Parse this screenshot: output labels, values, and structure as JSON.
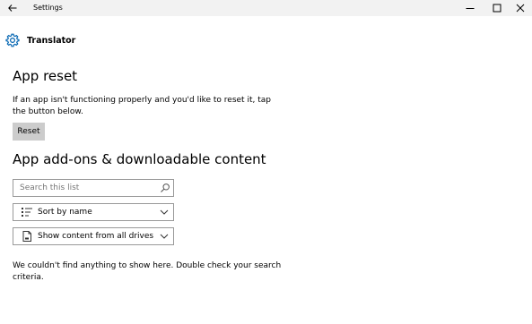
{
  "window": {
    "title": "Settings"
  },
  "header": {
    "app_name": "Translator"
  },
  "reset_section": {
    "title": "App reset",
    "description": "If an app isn't functioning properly and you'd like to reset it, tap the button below.",
    "button_label": "Reset"
  },
  "addons_section": {
    "title": "App add-ons & downloadable content",
    "search": {
      "placeholder": "Search this list",
      "value": ""
    },
    "sort": {
      "selected": "Sort by name"
    },
    "drives": {
      "selected": "Show content from all drives"
    },
    "empty_message": "We couldn't find anything to show here. Double check your search criteria."
  },
  "icons": {
    "back": "back-arrow-icon",
    "minimize": "minimize-icon",
    "maximize": "maximize-icon",
    "close": "close-icon",
    "settings": "gear-icon",
    "search": "search-icon",
    "sort": "sort-list-icon",
    "drive": "drive-icon",
    "dropdown": "chevron-down-icon"
  },
  "colors": {
    "accent": "#0063b1",
    "titlebar_bg": "#f2f2f2",
    "button_bg": "#cccccc",
    "field_border": "#999999"
  }
}
